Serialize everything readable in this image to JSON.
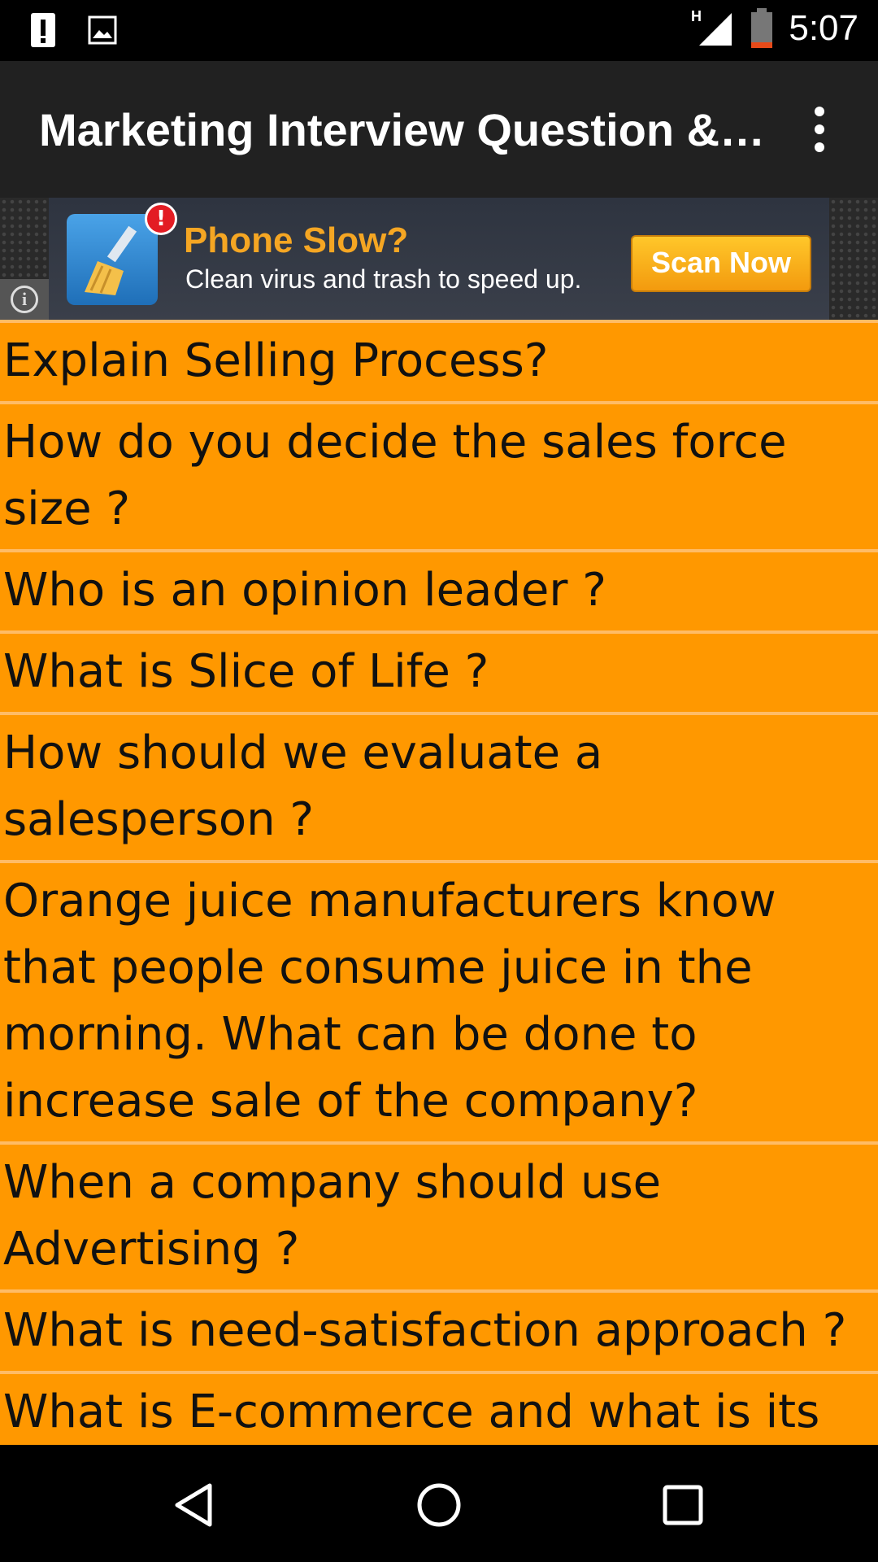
{
  "status_bar": {
    "time": "5:07",
    "network": "H",
    "icons": [
      "alert-icon",
      "image-notification-icon",
      "signal-icon",
      "battery-icon"
    ]
  },
  "app_bar": {
    "title": "Marketing Interview Question &…",
    "menu_icon": "more-vert-icon"
  },
  "ad": {
    "headline": "Phone Slow?",
    "body": "Clean virus and trash to speed up.",
    "cta": "Scan Now",
    "badge": "!",
    "info": "i"
  },
  "questions": [
    "Explain Selling Process?",
    "How do you decide the sales force size ?",
    "Who is an opinion leader ?",
    "What is Slice of Life ?",
    "How should we evaluate a salesperson ?",
    "Orange juice manufacturers know that people consume juice in the morning. What can be done to increase sale of the company?",
    "When a company should use Advertising ?",
    "What is need-satisfaction approach ?",
    "What is E-commerce and what is its selling process ?"
  ],
  "nav_bar": {
    "buttons": [
      "back-icon",
      "home-icon",
      "recents-icon"
    ]
  },
  "colors": {
    "list_item": "#ff9800",
    "app_bar": "#212121",
    "ad_headline": "#f5a623"
  }
}
